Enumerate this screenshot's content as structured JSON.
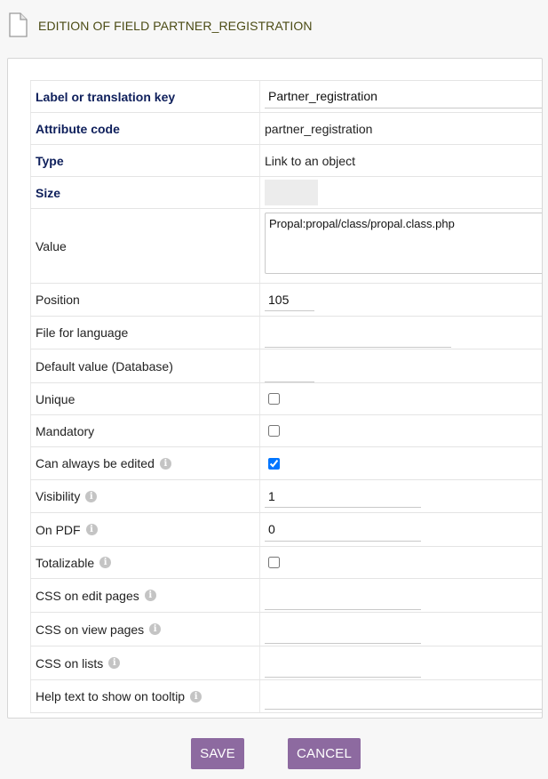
{
  "page": {
    "title": "EDITION OF FIELD PARTNER_REGISTRATION",
    "icon": "document-icon"
  },
  "form": {
    "label_key": {
      "label": "Label or translation key",
      "value": "Partner_registration"
    },
    "attribute_code": {
      "label": "Attribute code",
      "value": "partner_registration"
    },
    "type": {
      "label": "Type",
      "value": "Link to an object"
    },
    "size": {
      "label": "Size",
      "value": ""
    },
    "value": {
      "label": "Value",
      "value": "Propal:propal/class/propal.class.php"
    },
    "position": {
      "label": "Position",
      "value": "105"
    },
    "file_for_language": {
      "label": "File for language",
      "value": ""
    },
    "default_value": {
      "label": "Default value (Database)",
      "value": ""
    },
    "unique": {
      "label": "Unique",
      "checked": false
    },
    "mandatory": {
      "label": "Mandatory",
      "checked": false
    },
    "always_editable": {
      "label": "Can always be edited",
      "checked": true
    },
    "visibility": {
      "label": "Visibility",
      "value": "1"
    },
    "on_pdf": {
      "label": "On PDF",
      "value": "0"
    },
    "totalizable": {
      "label": "Totalizable",
      "checked": false
    },
    "css_edit": {
      "label": "CSS on edit pages",
      "value": ""
    },
    "css_view": {
      "label": "CSS on view pages",
      "value": ""
    },
    "css_lists": {
      "label": "CSS on lists",
      "value": ""
    },
    "help_text": {
      "label": "Help text to show on tooltip",
      "value": ""
    }
  },
  "buttons": {
    "save": "SAVE",
    "cancel": "CANCEL"
  },
  "colors": {
    "button": "#8d6aa0",
    "bold_label": "#0e1f5b",
    "title": "#4b4b14"
  }
}
